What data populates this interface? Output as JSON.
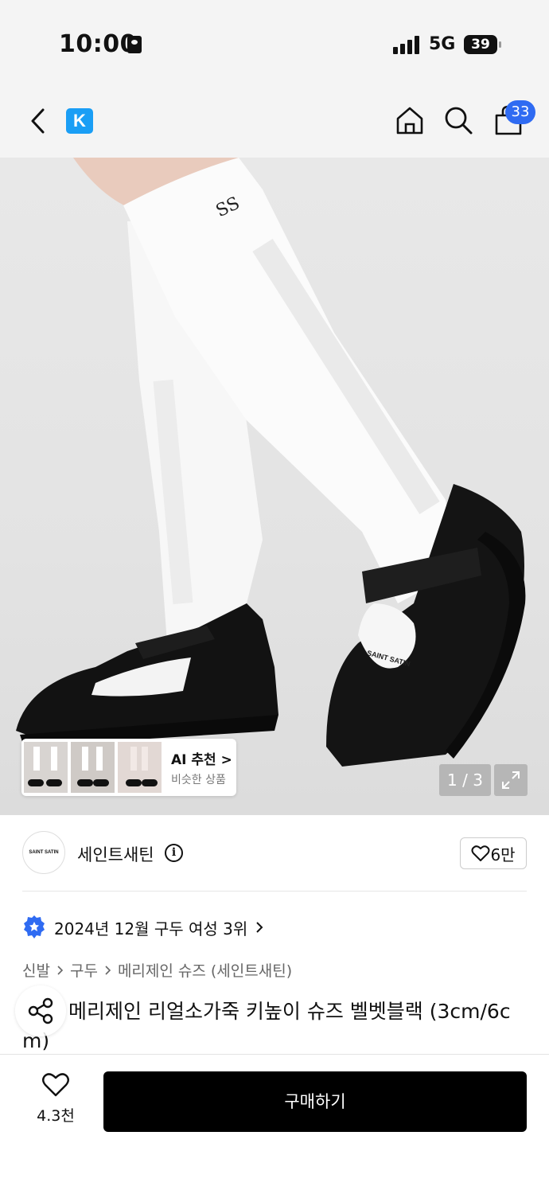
{
  "status_bar": {
    "time": "10:00",
    "network": "5G",
    "battery": "39"
  },
  "nav": {
    "cart_count": "33",
    "logo_letter": "K"
  },
  "gallery": {
    "page_indicator": "1 / 3",
    "ai_title": "AI 추천 >",
    "ai_subtitle": "비슷한 상품",
    "sock_logo_text": "SAINT SATIN"
  },
  "brand": {
    "logo_text": "SAINT SATIN",
    "name": "세인트새틴",
    "likes": "6만"
  },
  "ranking": {
    "text": "2024년 12월 구두 여성 3위"
  },
  "breadcrumb": [
    "신발",
    "구두",
    "메리제인 슈즈 (세인트새틴)"
  ],
  "product": {
    "title": "메리제인 리얼소가죽 키높이 슈즈 벨벳블랙 (3cm/6cm)"
  },
  "bottom": {
    "wish_count": "4.3천",
    "buy_label": "구매하기"
  },
  "colors": {
    "accent_blue": "#2f6bf2",
    "logo_blue": "#1a9ef5",
    "buy_button": "#000000"
  },
  "icons": [
    "back-icon",
    "home-icon",
    "search-icon",
    "bag-icon",
    "info-icon",
    "heart-icon",
    "badge-icon",
    "chevron-right-icon",
    "share-icon",
    "expand-icon"
  ]
}
